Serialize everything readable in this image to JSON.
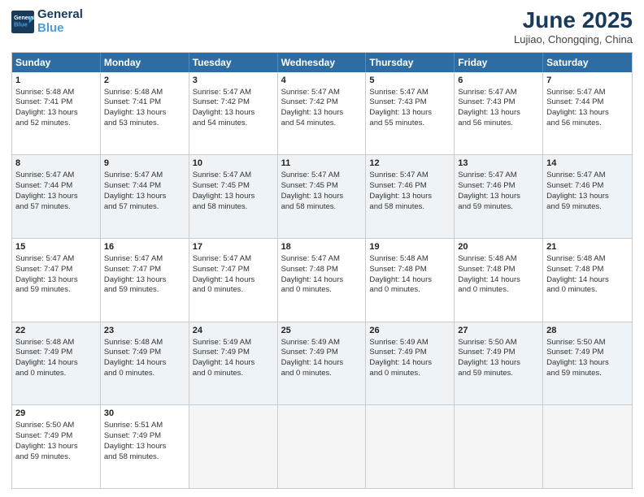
{
  "logo": {
    "line1": "General",
    "line2": "Blue"
  },
  "title": "June 2025",
  "subtitle": "Lujiao, Chongqing, China",
  "days_of_week": [
    "Sunday",
    "Monday",
    "Tuesday",
    "Wednesday",
    "Thursday",
    "Friday",
    "Saturday"
  ],
  "weeks": [
    [
      {
        "day": 1,
        "lines": [
          "Sunrise: 5:48 AM",
          "Sunset: 7:41 PM",
          "Daylight: 13 hours",
          "and 52 minutes."
        ]
      },
      {
        "day": 2,
        "lines": [
          "Sunrise: 5:48 AM",
          "Sunset: 7:41 PM",
          "Daylight: 13 hours",
          "and 53 minutes."
        ]
      },
      {
        "day": 3,
        "lines": [
          "Sunrise: 5:47 AM",
          "Sunset: 7:42 PM",
          "Daylight: 13 hours",
          "and 54 minutes."
        ]
      },
      {
        "day": 4,
        "lines": [
          "Sunrise: 5:47 AM",
          "Sunset: 7:42 PM",
          "Daylight: 13 hours",
          "and 54 minutes."
        ]
      },
      {
        "day": 5,
        "lines": [
          "Sunrise: 5:47 AM",
          "Sunset: 7:43 PM",
          "Daylight: 13 hours",
          "and 55 minutes."
        ]
      },
      {
        "day": 6,
        "lines": [
          "Sunrise: 5:47 AM",
          "Sunset: 7:43 PM",
          "Daylight: 13 hours",
          "and 56 minutes."
        ]
      },
      {
        "day": 7,
        "lines": [
          "Sunrise: 5:47 AM",
          "Sunset: 7:44 PM",
          "Daylight: 13 hours",
          "and 56 minutes."
        ]
      }
    ],
    [
      {
        "day": 8,
        "lines": [
          "Sunrise: 5:47 AM",
          "Sunset: 7:44 PM",
          "Daylight: 13 hours",
          "and 57 minutes."
        ]
      },
      {
        "day": 9,
        "lines": [
          "Sunrise: 5:47 AM",
          "Sunset: 7:44 PM",
          "Daylight: 13 hours",
          "and 57 minutes."
        ]
      },
      {
        "day": 10,
        "lines": [
          "Sunrise: 5:47 AM",
          "Sunset: 7:45 PM",
          "Daylight: 13 hours",
          "and 58 minutes."
        ]
      },
      {
        "day": 11,
        "lines": [
          "Sunrise: 5:47 AM",
          "Sunset: 7:45 PM",
          "Daylight: 13 hours",
          "and 58 minutes."
        ]
      },
      {
        "day": 12,
        "lines": [
          "Sunrise: 5:47 AM",
          "Sunset: 7:46 PM",
          "Daylight: 13 hours",
          "and 58 minutes."
        ]
      },
      {
        "day": 13,
        "lines": [
          "Sunrise: 5:47 AM",
          "Sunset: 7:46 PM",
          "Daylight: 13 hours",
          "and 59 minutes."
        ]
      },
      {
        "day": 14,
        "lines": [
          "Sunrise: 5:47 AM",
          "Sunset: 7:46 PM",
          "Daylight: 13 hours",
          "and 59 minutes."
        ]
      }
    ],
    [
      {
        "day": 15,
        "lines": [
          "Sunrise: 5:47 AM",
          "Sunset: 7:47 PM",
          "Daylight: 13 hours",
          "and 59 minutes."
        ]
      },
      {
        "day": 16,
        "lines": [
          "Sunrise: 5:47 AM",
          "Sunset: 7:47 PM",
          "Daylight: 13 hours",
          "and 59 minutes."
        ]
      },
      {
        "day": 17,
        "lines": [
          "Sunrise: 5:47 AM",
          "Sunset: 7:47 PM",
          "Daylight: 14 hours",
          "and 0 minutes."
        ]
      },
      {
        "day": 18,
        "lines": [
          "Sunrise: 5:47 AM",
          "Sunset: 7:48 PM",
          "Daylight: 14 hours",
          "and 0 minutes."
        ]
      },
      {
        "day": 19,
        "lines": [
          "Sunrise: 5:48 AM",
          "Sunset: 7:48 PM",
          "Daylight: 14 hours",
          "and 0 minutes."
        ]
      },
      {
        "day": 20,
        "lines": [
          "Sunrise: 5:48 AM",
          "Sunset: 7:48 PM",
          "Daylight: 14 hours",
          "and 0 minutes."
        ]
      },
      {
        "day": 21,
        "lines": [
          "Sunrise: 5:48 AM",
          "Sunset: 7:48 PM",
          "Daylight: 14 hours",
          "and 0 minutes."
        ]
      }
    ],
    [
      {
        "day": 22,
        "lines": [
          "Sunrise: 5:48 AM",
          "Sunset: 7:49 PM",
          "Daylight: 14 hours",
          "and 0 minutes."
        ]
      },
      {
        "day": 23,
        "lines": [
          "Sunrise: 5:48 AM",
          "Sunset: 7:49 PM",
          "Daylight: 14 hours",
          "and 0 minutes."
        ]
      },
      {
        "day": 24,
        "lines": [
          "Sunrise: 5:49 AM",
          "Sunset: 7:49 PM",
          "Daylight: 14 hours",
          "and 0 minutes."
        ]
      },
      {
        "day": 25,
        "lines": [
          "Sunrise: 5:49 AM",
          "Sunset: 7:49 PM",
          "Daylight: 14 hours",
          "and 0 minutes."
        ]
      },
      {
        "day": 26,
        "lines": [
          "Sunrise: 5:49 AM",
          "Sunset: 7:49 PM",
          "Daylight: 14 hours",
          "and 0 minutes."
        ]
      },
      {
        "day": 27,
        "lines": [
          "Sunrise: 5:50 AM",
          "Sunset: 7:49 PM",
          "Daylight: 13 hours",
          "and 59 minutes."
        ]
      },
      {
        "day": 28,
        "lines": [
          "Sunrise: 5:50 AM",
          "Sunset: 7:49 PM",
          "Daylight: 13 hours",
          "and 59 minutes."
        ]
      }
    ],
    [
      {
        "day": 29,
        "lines": [
          "Sunrise: 5:50 AM",
          "Sunset: 7:49 PM",
          "Daylight: 13 hours",
          "and 59 minutes."
        ]
      },
      {
        "day": 30,
        "lines": [
          "Sunrise: 5:51 AM",
          "Sunset: 7:49 PM",
          "Daylight: 13 hours",
          "and 58 minutes."
        ]
      },
      {
        "day": null,
        "lines": []
      },
      {
        "day": null,
        "lines": []
      },
      {
        "day": null,
        "lines": []
      },
      {
        "day": null,
        "lines": []
      },
      {
        "day": null,
        "lines": []
      }
    ]
  ]
}
